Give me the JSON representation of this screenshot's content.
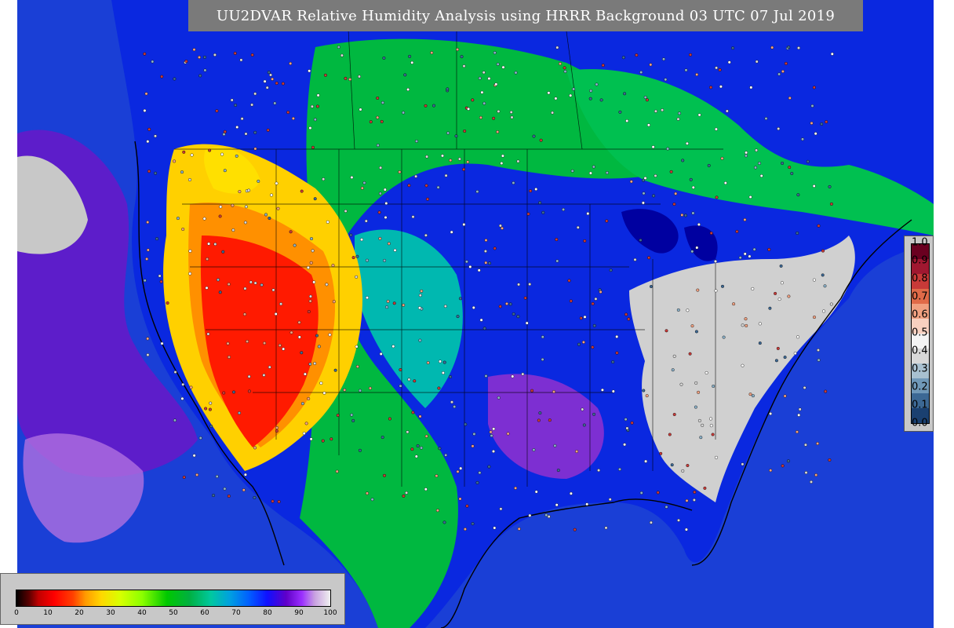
{
  "title": "UU2DVAR Relative Humidity Analysis using HRRR Background 03 UTC 07 Jul 2019",
  "rh_colorbar": {
    "ticks": [
      "0",
      "10",
      "20",
      "30",
      "40",
      "50",
      "60",
      "70",
      "80",
      "90",
      "100"
    ],
    "values": [
      0,
      10,
      20,
      30,
      40,
      50,
      60,
      70,
      80,
      90,
      100
    ]
  },
  "increment_colorbar": {
    "ticks": [
      "1.0",
      "0.9",
      "0.8",
      "0.7",
      "0.6",
      "0.5",
      "0.4",
      "0.3",
      "0.2",
      "0.1",
      "0.0"
    ],
    "colors": [
      "#6a0020",
      "#a01830",
      "#c83a38",
      "#e06a48",
      "#f0a080",
      "#f8d0c0",
      "#f4f4f4",
      "#d8d8d8",
      "#a8c0d0",
      "#7098b8",
      "#3c6894",
      "#1a4070"
    ]
  },
  "colors": {
    "ocean": "#1a3fd6",
    "land_moist": "#0a28e0",
    "land_mid": "#00b8a0",
    "land_dry": "#ff1a00",
    "very_moist": "#c8c8c8",
    "coastline": "#000000",
    "title_bg": "#7a7a7a"
  }
}
